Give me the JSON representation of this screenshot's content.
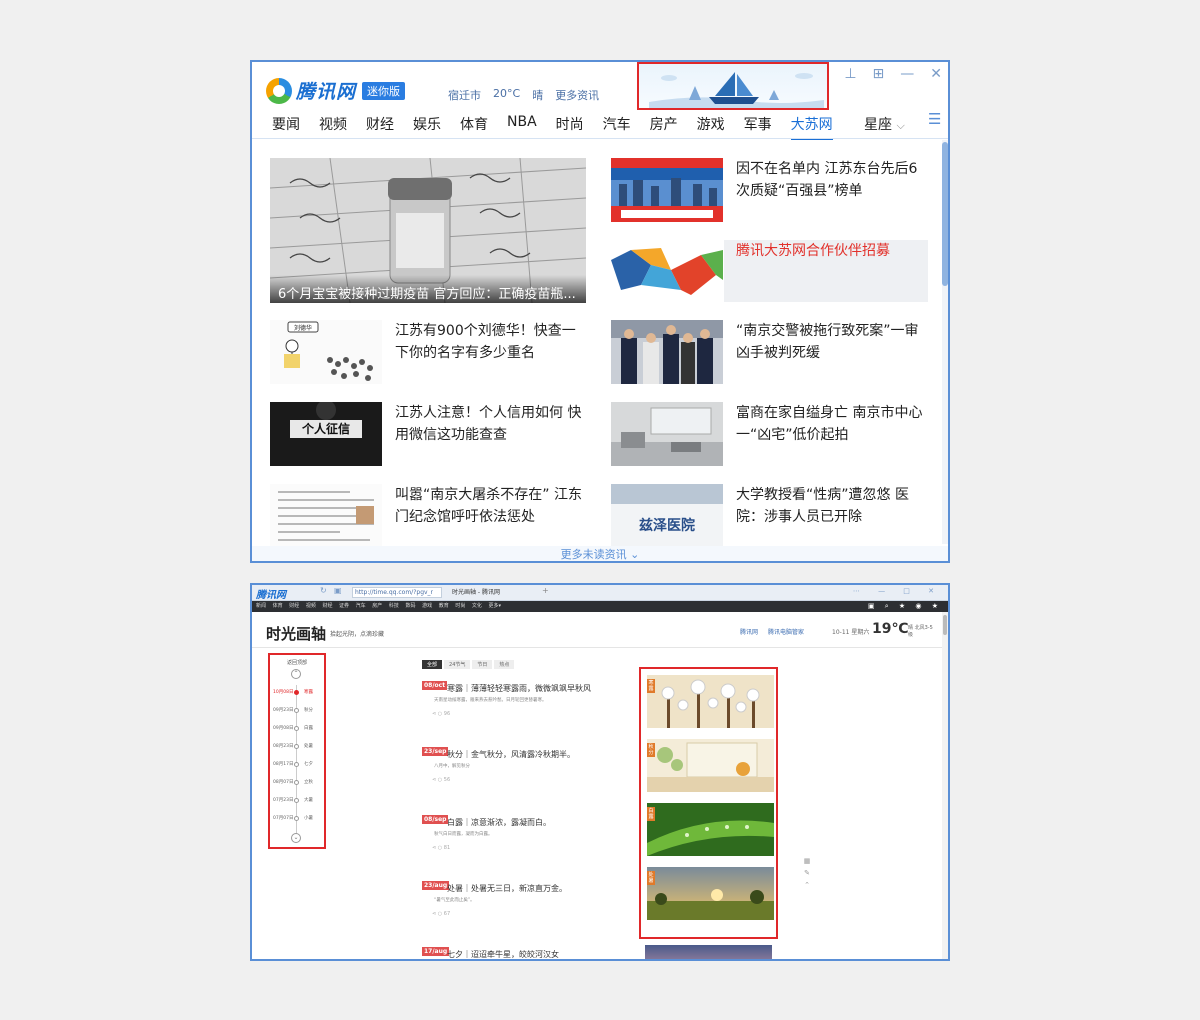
{
  "app": {
    "logo_text": "腾讯网",
    "mini_badge": "迷你版",
    "weather": {
      "city": "宿迁市",
      "temp": "20°C",
      "condition": "晴",
      "more": "更多资讯"
    },
    "window_controls": [
      "pin",
      "maximize",
      "minimize",
      "close"
    ]
  },
  "nav": {
    "items": [
      "要闻",
      "视频",
      "财经",
      "娱乐",
      "体育",
      "NBA",
      "时尚",
      "汽车",
      "房产",
      "游戏",
      "军事",
      "大苏网"
    ],
    "active": "大苏网",
    "more": "星座",
    "menu_icon": "menu-icon"
  },
  "news": {
    "hero_caption": "6个月宝宝被接种过期疫苗 官方回应：正确疫苗瓶...",
    "right_top": [
      {
        "title": "因不在名单内 江苏东台先后6次质疑“百强县”榜单"
      },
      {
        "title": "腾讯大苏网合作伙伴招募",
        "highlight": true
      }
    ],
    "rows": [
      {
        "left": "江苏有900个刘德华！快查一下你的名字有多少重名",
        "right": "“南京交警被拖行致死案”一审凶手被判死缓"
      },
      {
        "left": "江苏人注意！个人信用如何 快用微信这功能查查",
        "right": "富商在家自缢身亡 南京市中心一“凶宅”低价起拍"
      },
      {
        "left": "叫嚣“南京大屠杀不存在” 江东门纪念馆呼吁依法惩处",
        "right": "大学教授看“性病”遭忽悠 医院：涉事人员已开除"
      }
    ],
    "more_unread": "更多未读资讯",
    "thumb_text": {
      "credit": "个人征信",
      "cartoon": "刘德华",
      "hospital": "兹泽医院"
    }
  },
  "browser2": {
    "logo": "腾讯网",
    "url": "http://time.qq.com/?pgv_r",
    "tab_title": "时光画轴 - 腾讯网",
    "top_nav": [
      "新闻",
      "体育",
      "财经",
      "视频",
      "财经",
      "证券",
      "汽车",
      "房产",
      "科技",
      "数码",
      "游戏",
      "教育",
      "时尚",
      "文化",
      "更多▾"
    ],
    "site_title": "时光画轴",
    "site_sub": "拾起光阴，点滴珍藏",
    "header_links": [
      "腾讯网",
      "腾讯电脑管家"
    ],
    "date": "10-11 星期六",
    "temp": "19℃",
    "temp_meta": "晴 北风3-5级",
    "timeline": {
      "label": "返回顶部",
      "rows": [
        {
          "date": "10月08日",
          "name": "寒露",
          "active": true
        },
        {
          "date": "09月23日",
          "name": "秋分"
        },
        {
          "date": "09月08日",
          "name": "白露"
        },
        {
          "date": "08月23日",
          "name": "处暑"
        },
        {
          "date": "08月17日",
          "name": "七夕"
        },
        {
          "date": "08月07日",
          "name": "立秋"
        },
        {
          "date": "07月23日",
          "name": "大暑"
        },
        {
          "date": "07月07日",
          "name": "小暑"
        }
      ]
    },
    "filter_tabs": [
      "全部",
      "24节气",
      "节日",
      "热点"
    ],
    "entries": [
      {
        "date": "08/oct",
        "title": "寒露｜薄薄轻轻寒露雨，微微飒飒早秋风",
        "desc": "天南星动候寒露，雁来燕去惹吟愁。日月轮回更替暑寒。",
        "meta": "96"
      },
      {
        "date": "23/sep",
        "title": "秋分｜金气秋分，风清露冷秋期半。",
        "desc": "八月中，解见秋分",
        "meta": "56"
      },
      {
        "date": "08/sep",
        "title": "白露｜凉意渐浓，露凝而白。",
        "desc": "秋气白日而露，凝而为白露。",
        "meta": "81"
      },
      {
        "date": "23/aug",
        "title": "处暑｜处暑无三日，新凉直万金。",
        "desc": "“暑气至此而止矣”。",
        "meta": "67"
      },
      {
        "date": "17/aug",
        "title": "七夕｜迢迢牵牛星，皎皎河汉女",
        "desc": "",
        "meta": ""
      }
    ],
    "image_tags": [
      "寒露",
      "秋分",
      "白露",
      "处暑"
    ]
  }
}
